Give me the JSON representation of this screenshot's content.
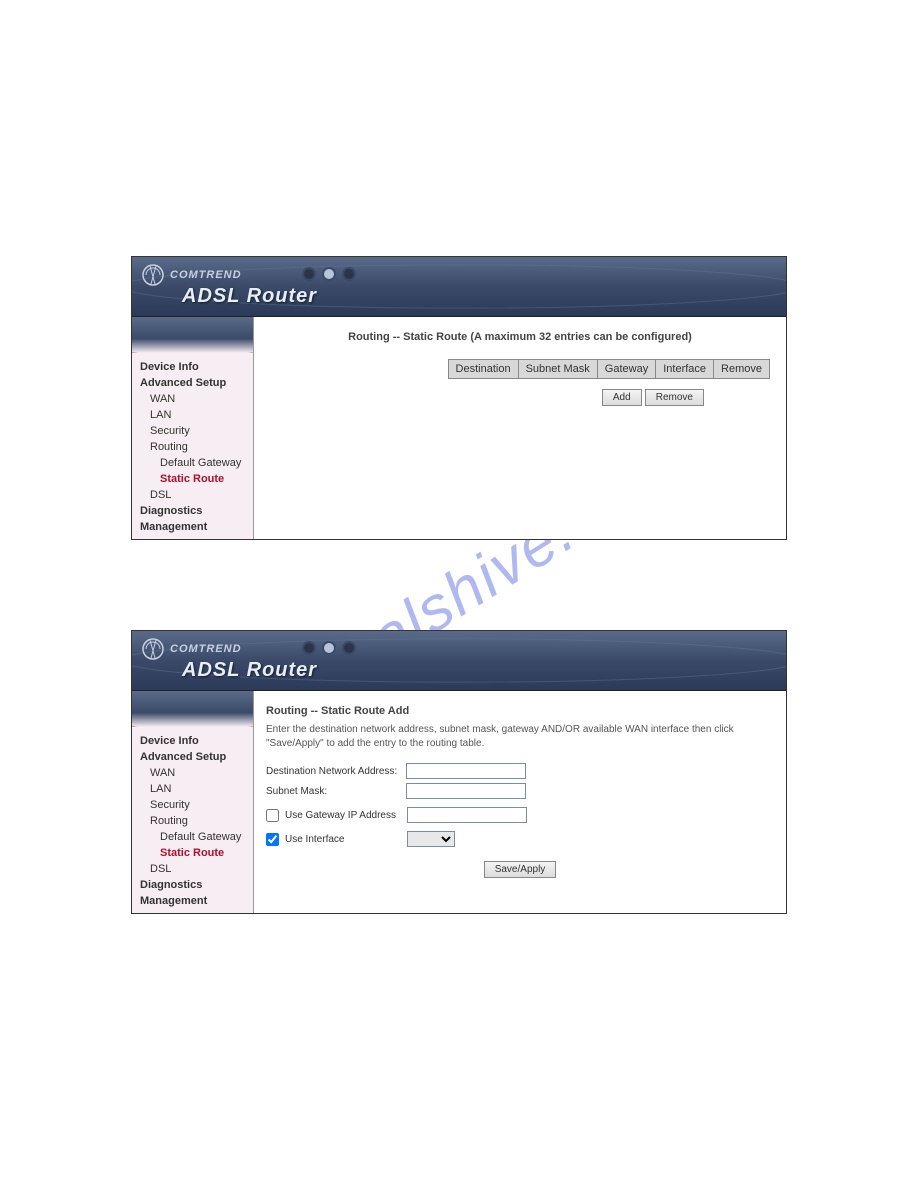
{
  "brand": {
    "company": "COMTREND",
    "product": "ADSL Router"
  },
  "watermark": "manualshive.com",
  "sidebar": {
    "items": [
      {
        "label": "Device Info",
        "bold": true,
        "indent": 0
      },
      {
        "label": "Advanced Setup",
        "bold": true,
        "indent": 0
      },
      {
        "label": "WAN",
        "bold": false,
        "indent": 1
      },
      {
        "label": "LAN",
        "bold": false,
        "indent": 1
      },
      {
        "label": "Security",
        "bold": false,
        "indent": 1
      },
      {
        "label": "Routing",
        "bold": false,
        "indent": 1
      },
      {
        "label": "Default Gateway",
        "bold": false,
        "indent": 2
      },
      {
        "label": "Static Route",
        "bold": false,
        "indent": 2,
        "active": true
      },
      {
        "label": "DSL",
        "bold": false,
        "indent": 1
      },
      {
        "label": "Diagnostics",
        "bold": true,
        "indent": 0
      },
      {
        "label": "Management",
        "bold": true,
        "indent": 0
      }
    ]
  },
  "panel1": {
    "title": "Routing -- Static Route (A maximum 32 entries can be configured)",
    "columns": [
      "Destination",
      "Subnet Mask",
      "Gateway",
      "Interface",
      "Remove"
    ],
    "buttons": {
      "add": "Add",
      "remove": "Remove"
    }
  },
  "panel2": {
    "title": "Routing -- Static Route Add",
    "help": "Enter the destination network address, subnet mask, gateway AND/OR available WAN interface then click \"Save/Apply\" to add the entry to the routing table.",
    "fields": {
      "dest": "Destination Network Address:",
      "mask": "Subnet Mask:",
      "usegw": "Use Gateway IP Address",
      "useif": "Use Interface"
    },
    "values": {
      "dest": "",
      "mask": "",
      "gw": "",
      "usegw_checked": false,
      "useif_checked": true
    },
    "buttons": {
      "save": "Save/Apply"
    }
  }
}
